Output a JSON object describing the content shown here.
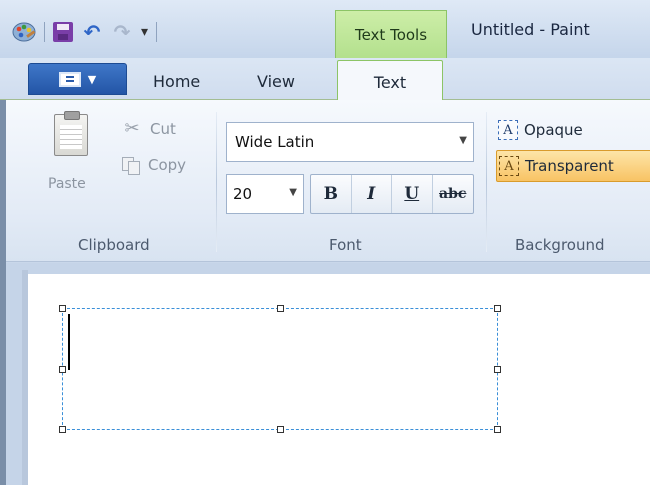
{
  "window": {
    "title": "Untitled - Paint",
    "context_tab": "Text Tools"
  },
  "quick_access": {
    "overflow_glyph": "▾"
  },
  "tabs": {
    "home": "Home",
    "view": "View",
    "text": "Text"
  },
  "clipboard": {
    "paste": "Paste",
    "cut": "Cut",
    "copy": "Copy",
    "group": "Clipboard"
  },
  "font": {
    "family": "Wide Latin",
    "size": "20",
    "bold": "B",
    "italic": "I",
    "underline": "U",
    "strikethrough": "abc",
    "group": "Font"
  },
  "background": {
    "opaque": "Opaque",
    "transparent": "Transparent",
    "selected": "transparent",
    "group": "Background",
    "icon_glyph": "A"
  },
  "colors": {
    "context_tab": "#b3e08d",
    "app_menu": "#2355a6",
    "selected_option": "#f8c364",
    "selection_border": "#3a8fd8"
  }
}
